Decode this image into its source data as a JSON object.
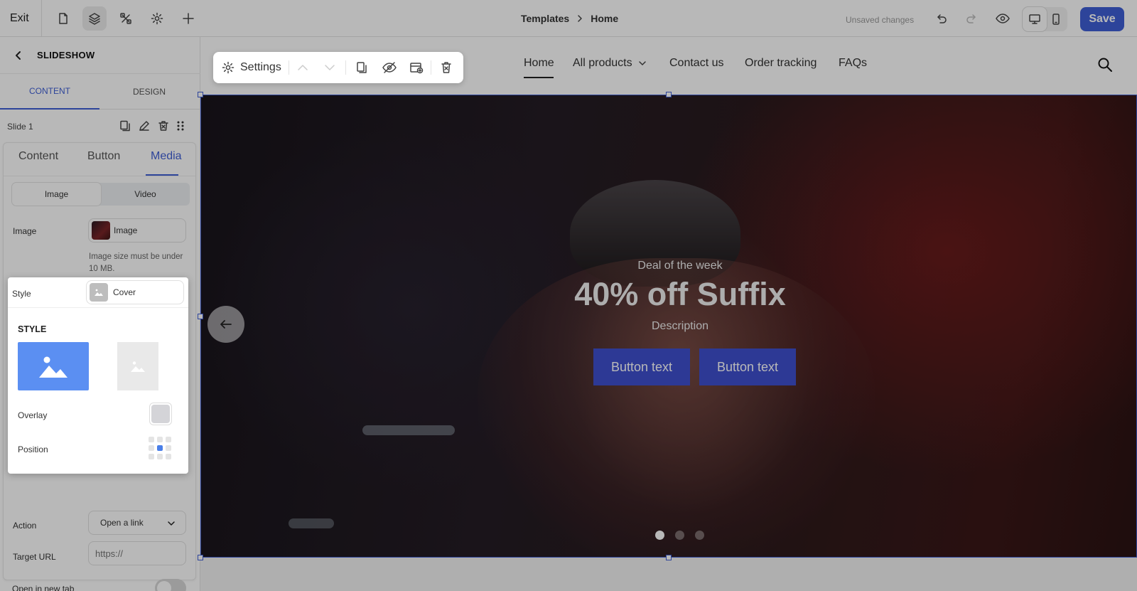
{
  "topbar": {
    "exit_label": "Exit",
    "breadcrumb": {
      "parent": "Templates",
      "current": "Home"
    },
    "unsaved": "Unsaved changes",
    "save_label": "Save"
  },
  "sidebar": {
    "section_title": "SLIDESHOW",
    "tabs": [
      "CONTENT",
      "DESIGN"
    ],
    "slide_label": "Slide 1",
    "subtabs": [
      "Content",
      "Button",
      "Media"
    ],
    "media_type": [
      "Image",
      "Video"
    ],
    "image_label": "Image",
    "image_value": "Image",
    "image_hint_line1": "Image size must be under",
    "image_hint_line2": "10 MB.",
    "style_label": "Style",
    "style_value": "Cover",
    "action_label": "Action",
    "action_value": "Open a link",
    "target_label": "Target URL",
    "target_placeholder": "https://",
    "newtab_label": "Open in new tab",
    "newtab_on": false
  },
  "style_panel": {
    "heading": "STYLE",
    "options": [
      "cover",
      "contain"
    ],
    "selected": "cover",
    "overlay_label": "Overlay",
    "position_label": "Position",
    "position_selected": "center"
  },
  "preview": {
    "toolbar": {
      "settings_label": "Settings"
    },
    "nav": [
      "Home",
      "All products",
      "Contact us",
      "Order tracking",
      "FAQs"
    ],
    "nav_active": "Home",
    "hero": {
      "eyebrow": "Deal of the week",
      "heading": "40% off Suffix",
      "description": "Description",
      "buttons": [
        "Button text",
        "Button text"
      ],
      "slides": 3,
      "active_slide": 1
    }
  },
  "colors": {
    "accent": "#3f5fd6",
    "hero_button": "#3f4fcf",
    "style_selected": "#5b8ff2"
  }
}
